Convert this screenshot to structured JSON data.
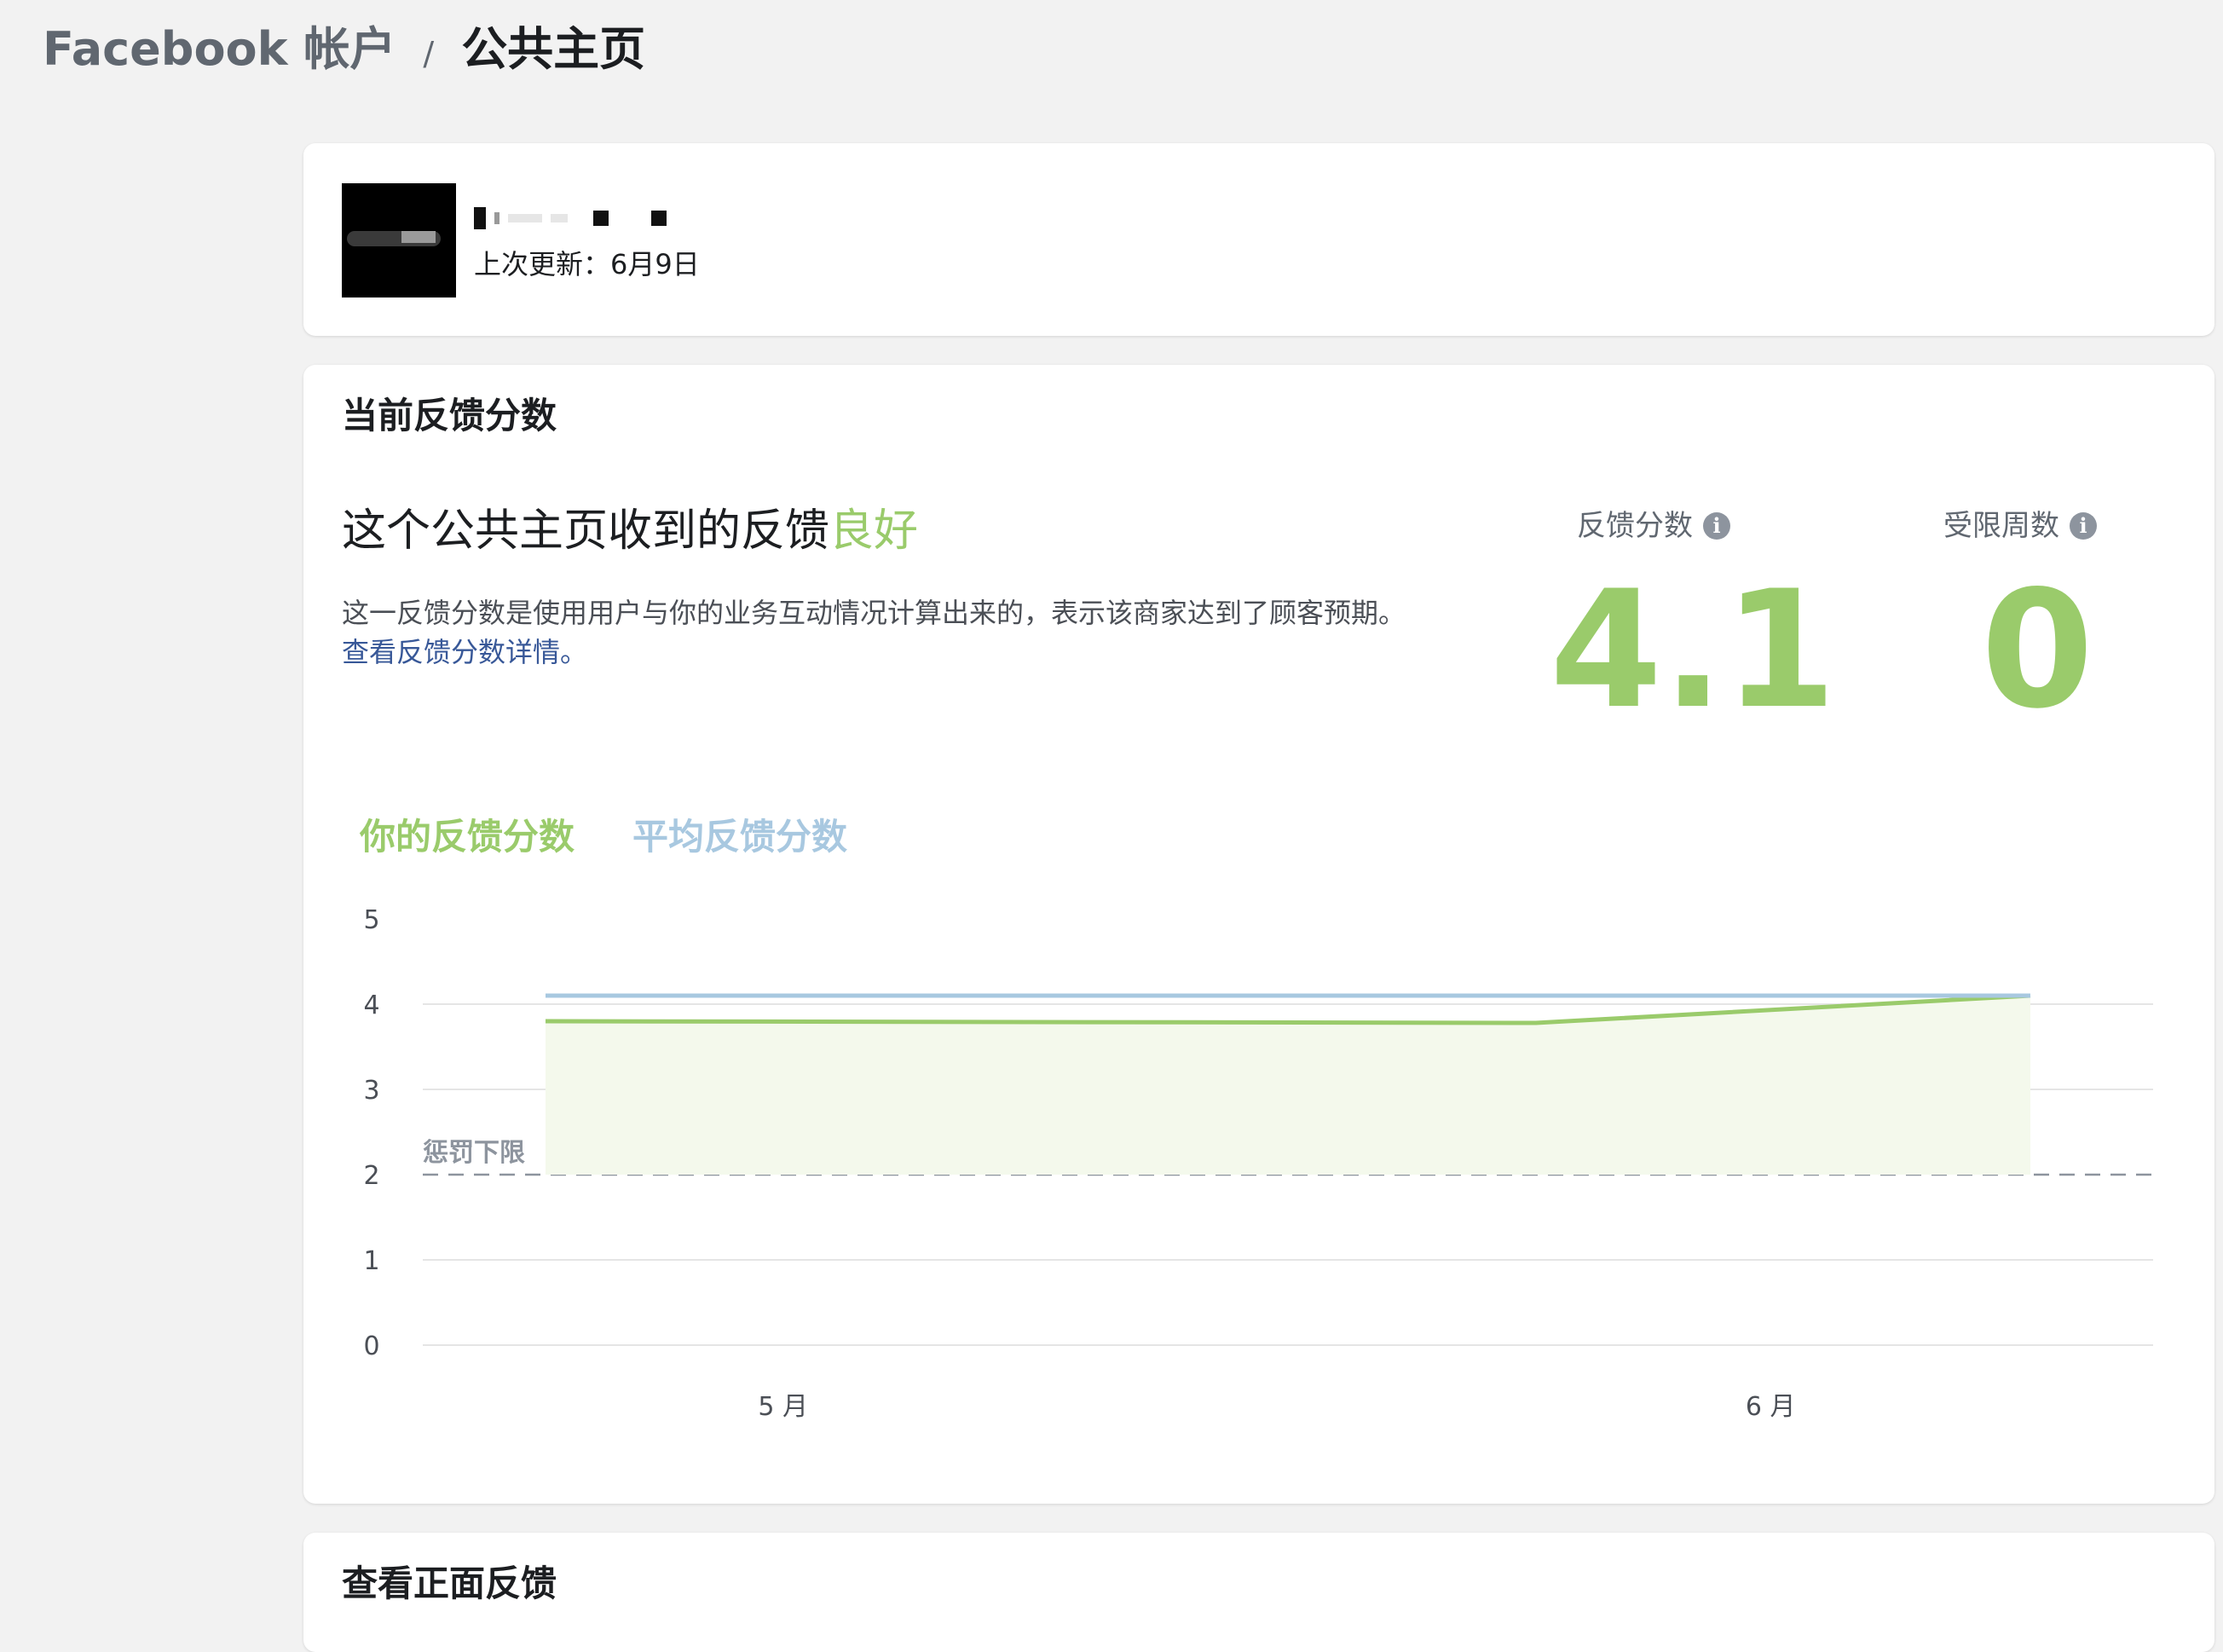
{
  "breadcrumb": {
    "parent": "Facebook 帐户",
    "separator": "/",
    "current": "公共主页"
  },
  "page_card": {
    "last_updated": "上次更新：6月9日"
  },
  "score_card": {
    "title": "当前反馈分数",
    "headline_prefix": "这个公共主页收到的反馈",
    "headline_rating": "良好",
    "description": "这一反馈分数是使用用户与你的业务互动情况计算出来的，表示该商家达到了顾客预期。",
    "details_link": "查看反馈分数详情。",
    "metrics": [
      {
        "label": "反馈分数",
        "value": "4.1",
        "icon": "info-icon"
      },
      {
        "label": "受限周数",
        "value": "0",
        "icon": "info-icon"
      }
    ],
    "legend": {
      "yours": "你的反馈分数",
      "average": "平均反馈分数"
    }
  },
  "chart_data": {
    "type": "area",
    "x_ticks": [
      "5 月",
      "6 月"
    ],
    "y_ticks": [
      "5",
      "4",
      "3",
      "2",
      "1",
      "0"
    ],
    "ylim": [
      0,
      5
    ],
    "threshold": {
      "label": "惩罚下限",
      "value": 2
    },
    "series": [
      {
        "name": "你的反馈分数",
        "color": "#9acb6b",
        "x": [
          0,
          0.667,
          1
        ],
        "values": [
          3.8,
          3.78,
          4.1
        ]
      },
      {
        "name": "平均反馈分数",
        "color": "#a8c8e0",
        "x": [
          0,
          1
        ],
        "values": [
          4.1,
          4.1
        ]
      }
    ],
    "grid": true
  },
  "positive_card": {
    "title": "查看正面反馈"
  },
  "colors": {
    "good": "#9acb6b",
    "average": "#a8c8e0",
    "link": "#385898",
    "background": "#f2f2f2"
  }
}
